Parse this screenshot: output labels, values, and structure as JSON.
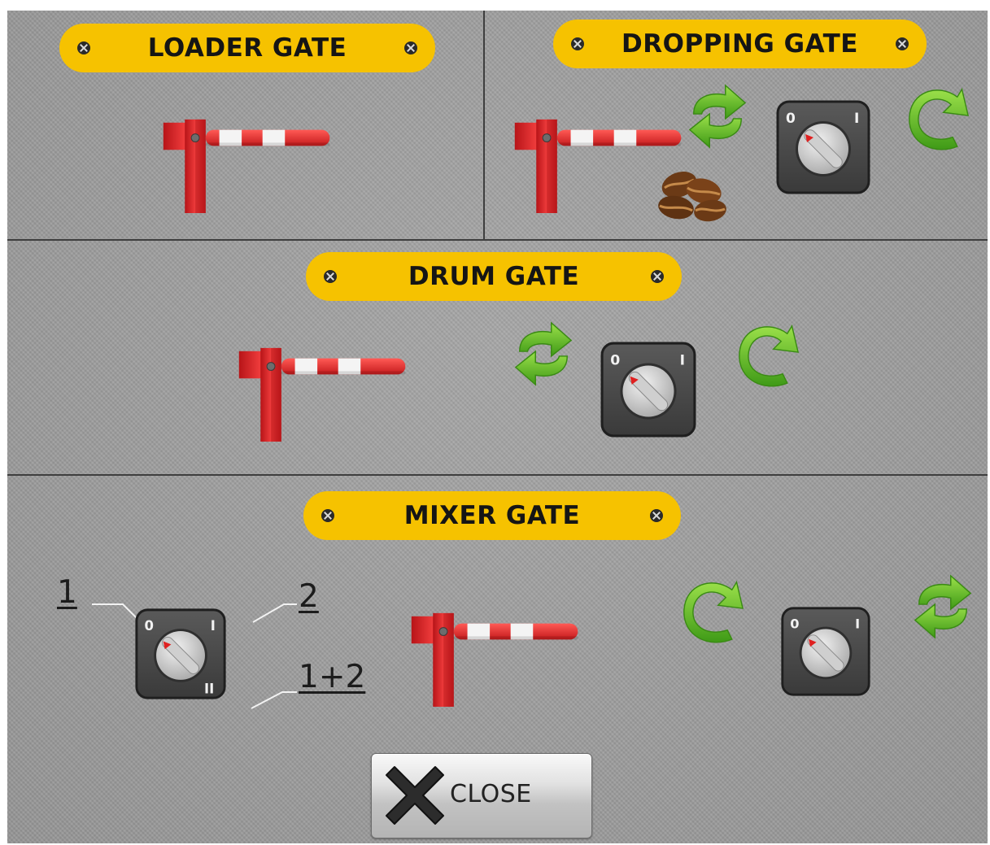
{
  "sections": {
    "loader": {
      "title": "LOADER GATE"
    },
    "dropping": {
      "title": "DROPPING GATE"
    },
    "drum": {
      "title": "DRUM GATE"
    },
    "mixer": {
      "title": "MIXER GATE",
      "selector_labels": {
        "one": "1",
        "two": "2",
        "both": "1+2"
      }
    }
  },
  "selector_switch": {
    "off_mark": "0",
    "on_mark": "I",
    "second_mark": "II"
  },
  "close_button": {
    "label": "CLOSE"
  },
  "icons": {
    "gate": "barrier-gate-icon",
    "cycle": "cycle-arrows-icon",
    "rotate": "rotate-arrow-icon",
    "selector": "selector-switch-icon",
    "coffee": "coffee-beans-icon",
    "close": "close-x-icon"
  },
  "colors": {
    "title_yellow": "#f6c200",
    "gate_red": "#e0262a",
    "arrow_green": "#6cc12d",
    "selector_body": "#4a4a4a",
    "background_gray": "#9a9a9a"
  }
}
